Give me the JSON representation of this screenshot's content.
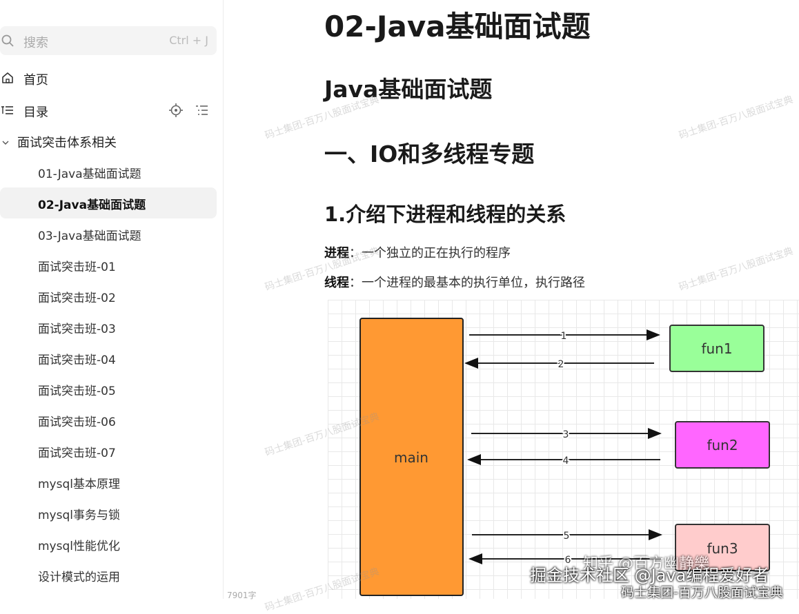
{
  "sidebar": {
    "search": {
      "placeholder": "搜索",
      "shortcut": "Ctrl + J"
    },
    "home_label": "首页",
    "toc_label": "目录",
    "group_label": "面试突击体系相关",
    "items": [
      {
        "label": "01-Java基础面试题",
        "active": false
      },
      {
        "label": "02-Java基础面试题",
        "active": true
      },
      {
        "label": "03-Java基础面试题",
        "active": false
      },
      {
        "label": "面试突击班-01",
        "active": false
      },
      {
        "label": "面试突击班-02",
        "active": false
      },
      {
        "label": "面试突击班-03",
        "active": false
      },
      {
        "label": "面试突击班-04",
        "active": false
      },
      {
        "label": "面试突击班-05",
        "active": false
      },
      {
        "label": "面试突击班-06",
        "active": false
      },
      {
        "label": "面试突击班-07",
        "active": false
      },
      {
        "label": "mysql基本原理",
        "active": false
      },
      {
        "label": "mysql事务与锁",
        "active": false
      },
      {
        "label": "mysql性能优化",
        "active": false
      },
      {
        "label": "设计模式的运用",
        "active": false
      }
    ],
    "word_count": "7901字"
  },
  "doc": {
    "title": "02-Java基础面试题",
    "h1": "Java基础面试题",
    "h2": "一、IO和多线程专题",
    "h3": "1.介绍下进程和线程的关系",
    "para1": {
      "term": "进程",
      "sep": "：",
      "text": "一个独立的正在执行的程序"
    },
    "para2": {
      "term": "线程",
      "sep": "：",
      "text": "一个进程的最基本的执行单位，执行路径"
    }
  },
  "diagram": {
    "main_label": "main",
    "functions": [
      {
        "label": "fun1",
        "color": "#99ff99",
        "call": "1",
        "ret": "2"
      },
      {
        "label": "fun2",
        "color": "#ff66ff",
        "call": "3",
        "ret": "4"
      },
      {
        "label": "fun3",
        "color": "#ffcccc",
        "call": "5",
        "ret": "6"
      }
    ],
    "main_color": "#ff9933"
  },
  "watermarks": {
    "repeat": "码士集团-百万八股面试宝典",
    "overlay1": "掘金技术社区 @Java编程爱好者",
    "overlay2": "码士集团-百万八股面试宝典",
    "overlay3": "知乎 @百方幽静樂"
  }
}
